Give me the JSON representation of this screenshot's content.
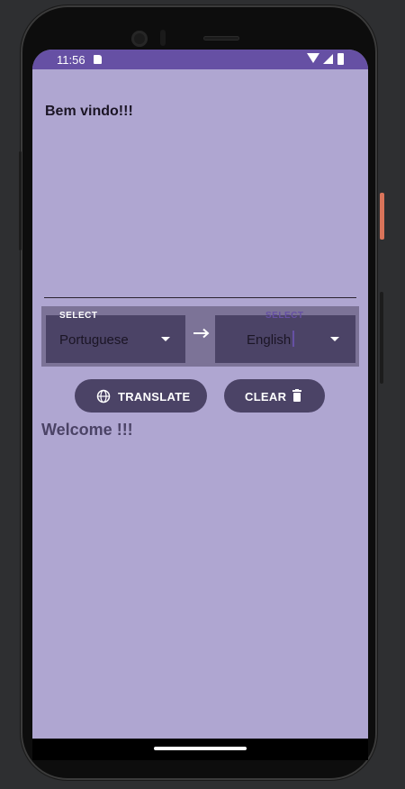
{
  "status_bar": {
    "time": "11:56"
  },
  "source": {
    "text": "Bem vindo!!!"
  },
  "language_bar": {
    "from": {
      "label": "SELECT",
      "value": "Portuguese"
    },
    "to": {
      "label": "SELECT",
      "value": "English"
    }
  },
  "buttons": {
    "translate": "TRANSLATE",
    "clear": "CLEAR"
  },
  "result": {
    "text": "Welcome !!!"
  },
  "colors": {
    "accent": "#6650a4",
    "screen_background": "#afa6d1",
    "button_background": "#4b4366"
  },
  "icons": [
    "sd-card-icon",
    "wifi-icon",
    "signal-icon",
    "battery-icon",
    "swap-arrow-icon",
    "globe-icon",
    "trash-icon",
    "dropdown-caret-icon"
  ]
}
